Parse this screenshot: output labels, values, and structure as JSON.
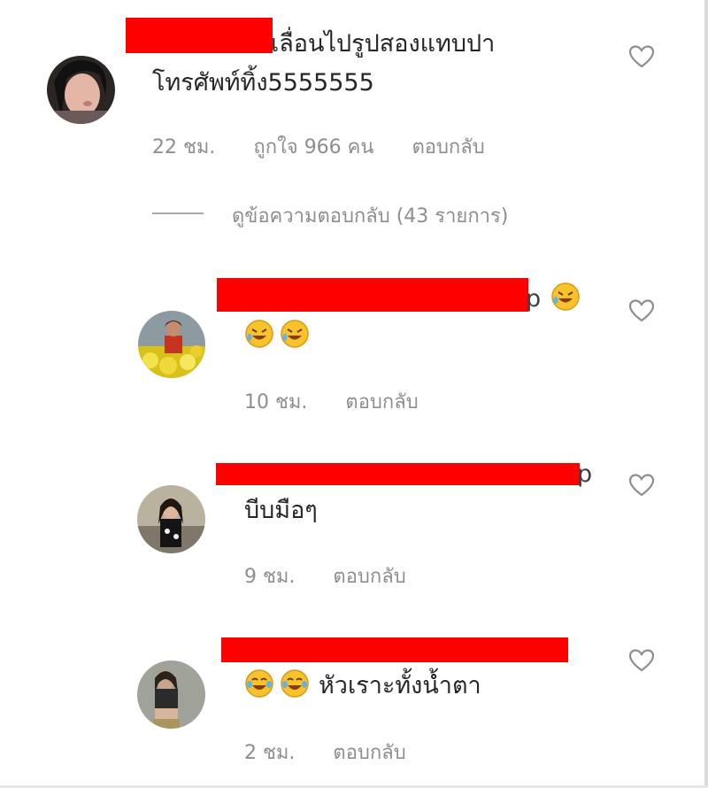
{
  "comments": [
    {
      "text_line1": "เลื่อนไปรูปสองแทบปา",
      "text_line2": "โทรศัพท์ทิ้ง5555555",
      "time": "22 ชม.",
      "likes": "ถูกใจ 966 คน",
      "reply": "ตอบกลับ"
    }
  ],
  "view_replies": "ดูข้อความตอบกลับ (43 รายการ)",
  "replies": [
    {
      "text": "",
      "username_tail": "p",
      "time": "10 ชม.",
      "reply": "ตอบกลับ",
      "emoji": "rolling-laughing-icon"
    },
    {
      "text": "บีบมือๆ",
      "username_tail": "p",
      "time": "9 ชม.",
      "reply": "ตอบกลับ"
    },
    {
      "text": "หัวเราะทั้งน้ำตา",
      "time": "2 ชม.",
      "reply": "ตอบกลับ",
      "emoji": "tears-of-joy-icon"
    }
  ],
  "colors": {
    "redaction": "#ff0000",
    "meta_text": "#8e8e8e",
    "body_text": "#262626"
  }
}
